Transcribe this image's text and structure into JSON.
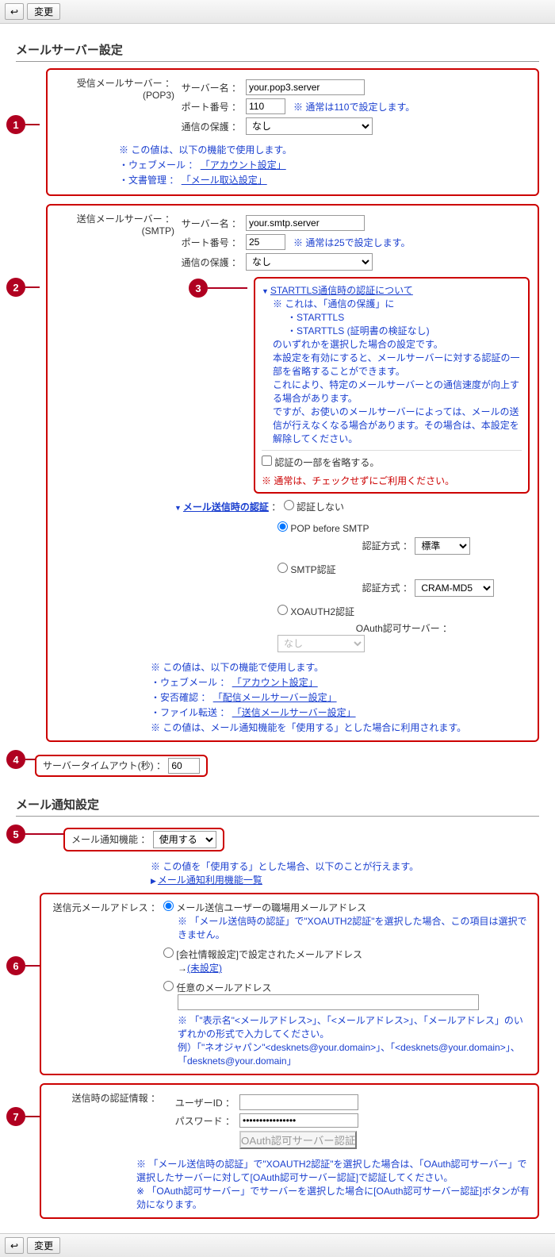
{
  "toolbar": {
    "back": "↩",
    "change": "変更"
  },
  "section1": {
    "title": "メールサーバー設定"
  },
  "pop3": {
    "header1": "受信メールサーバー ：",
    "header2": "(POP3)",
    "server_label": "サーバー名 ：",
    "server_value": "your.pop3.server",
    "port_label": "ポート番号 ：",
    "port_value": "110",
    "port_note": "※ 通常は110で設定します。",
    "protect_label": "通信の保護 ：",
    "protect_value": "なし",
    "use_note": "※ この値は、以下の機能で使用します。",
    "link1_prefix": "・ウェブメール ：",
    "link1": "「アカウント設定」",
    "link2_prefix": "・文書管理 ：",
    "link2": "「メール取込設定」"
  },
  "smtp": {
    "header1": "送信メールサーバー ：",
    "header2": "(SMTP)",
    "server_label": "サーバー名 ：",
    "server_value": "your.smtp.server",
    "port_label": "ポート番号 ：",
    "port_value": "25",
    "port_note": "※ 通常は25で設定します。",
    "protect_label": "通信の保護 ：",
    "protect_value": "なし",
    "starttls_title": "STARTTLS通信時の認証について",
    "starttls_note1": "※ これは、「通信の保護」に",
    "starttls_opt1": "・STARTTLS",
    "starttls_opt2": "・STARTTLS (証明書の検証なし)",
    "starttls_note2": "のいずれかを選択した場合の設定です。",
    "starttls_note3": "本設定を有効にすると、メールサーバーに対する認証の一部を省略することができます。",
    "starttls_note4": "これにより、特定のメールサーバーとの通信速度が向上する場合があります。",
    "starttls_note5": "ですが、お使いのメールサーバーによっては、メールの送信が行えなくなる場合があります。その場合は、本設定を解除してください。",
    "starttls_check": "認証の一部を省略する。",
    "starttls_warn": "※ 通常は、チェックせずにご利用ください。",
    "auth_title": "メール送信時の認証",
    "auth_none": "認証しない",
    "auth_pop": "POP before SMTP",
    "auth_pop_method_label": "認証方式 ：",
    "auth_pop_method": "標準",
    "auth_smtp": "SMTP認証",
    "auth_smtp_method_label": "認証方式 ：",
    "auth_smtp_method": "CRAM-MD5",
    "auth_xoauth": "XOAUTH2認証",
    "auth_xoauth_label": "OAuth認可サーバー ：",
    "auth_xoauth_value": "なし",
    "use_note": "※ この値は、以下の機能で使用します。",
    "link1_prefix": "・ウェブメール ：",
    "link1": "「アカウント設定」",
    "link2_prefix": "・安否確認 ：",
    "link2": "「配信メールサーバー設定」",
    "link3_prefix": "・ファイル転送 ：",
    "link3": "「送信メールサーバー設定」",
    "note_final": "※ この値は、メール通知機能を「使用する」とした場合に利用されます。"
  },
  "timeout": {
    "label": "サーバータイムアウト(秒) ：",
    "value": "60"
  },
  "section2": {
    "title": "メール通知設定"
  },
  "notify": {
    "label": "メール通知機能 ：",
    "value": "使用する",
    "note": "※ この値を「使用する」とした場合、以下のことが行えます。",
    "link": "メール通知利用機能一覧"
  },
  "sender": {
    "label": "送信元メールアドレス ：",
    "opt1": "メール送信ユーザーの職場用メールアドレス",
    "opt1_note": "※ 「メール送信時の認証」で\"XOAUTH2認証\"を選択した場合、この項目は選択できません。",
    "opt2": "[会社情報設定]で設定されたメールアドレス",
    "opt2_arrow": "→",
    "opt2_link": "(未設定)",
    "opt3": "任意のメールアドレス",
    "note1": "※ 「\"表示名\"<メールアドレス>」、「<メールアドレス>」、「メールアドレス」のいずれかの形式で入力してください。",
    "note2": "例）「\"ネオジャパン\"<desknets@your.domain>」、「<desknets@your.domain>」、「desknets@your.domain」"
  },
  "authinfo": {
    "label": "送信時の認証情報 ：",
    "user_label": "ユーザーID ：",
    "user_value": "",
    "pass_label": "パスワード ：",
    "pass_value": "••••••••••••••••",
    "button": "OAuth認可サーバー認証",
    "note1": "※ 「メール送信時の認証」で\"XOAUTH2認証\"を選択した場合は、「OAuth認可サーバー」で選択したサーバーに対して[OAuth認可サーバー認証]で認証してください。",
    "note2": "※ 「OAuth認可サーバー」でサーバーを選択した場合に[OAuth認可サーバー認証]ボタンが有効になります。"
  },
  "callouts": [
    "1",
    "2",
    "3",
    "4",
    "5",
    "6",
    "7"
  ]
}
